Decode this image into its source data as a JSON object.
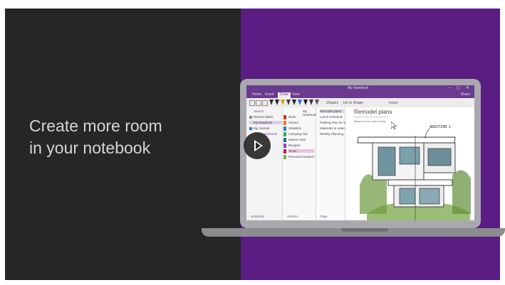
{
  "video": {
    "headline_line1": "Create more room",
    "headline_line2": "in your notebook",
    "play_icon": "play-icon",
    "colors": {
      "left_bg": "#262626",
      "right_bg": "#5a1d82",
      "text": "#d6d6d6"
    }
  },
  "onenote": {
    "app_title": "My Notebook",
    "window_controls": "– ▢ ✕",
    "ribbon_tabs": [
      "Home",
      "Insert",
      "Draw",
      "View"
    ],
    "active_tab": "Draw",
    "ribbon_right": "Share",
    "toolbar": {
      "shapes_label": "Shapes",
      "ink_to_shape_label": "Ink to Shape",
      "insert_label": "Insert"
    },
    "nav": {
      "search_label": "Search",
      "items": [
        "Recent Notes",
        "My Notebook",
        "My Journal",
        "Travel Notebook"
      ],
      "footer": "Notebook"
    },
    "sections": {
      "header": "My Notebook",
      "items": [
        "Work",
        "School",
        "Statistics",
        "Camping Trip",
        "Nature Club",
        "Recipes",
        "To do",
        "Personal research"
      ],
      "footer": "Section"
    },
    "pages": {
      "items": [
        "Remodel plans",
        "Lunch Schedule",
        "Parking Plan for Workers",
        "Materials to order",
        "Weekly Planning"
      ],
      "footer": "Page"
    },
    "page": {
      "title": "Remodel plans",
      "subtitle": "Based on our final review",
      "annotation": "ADDITION 1"
    }
  }
}
